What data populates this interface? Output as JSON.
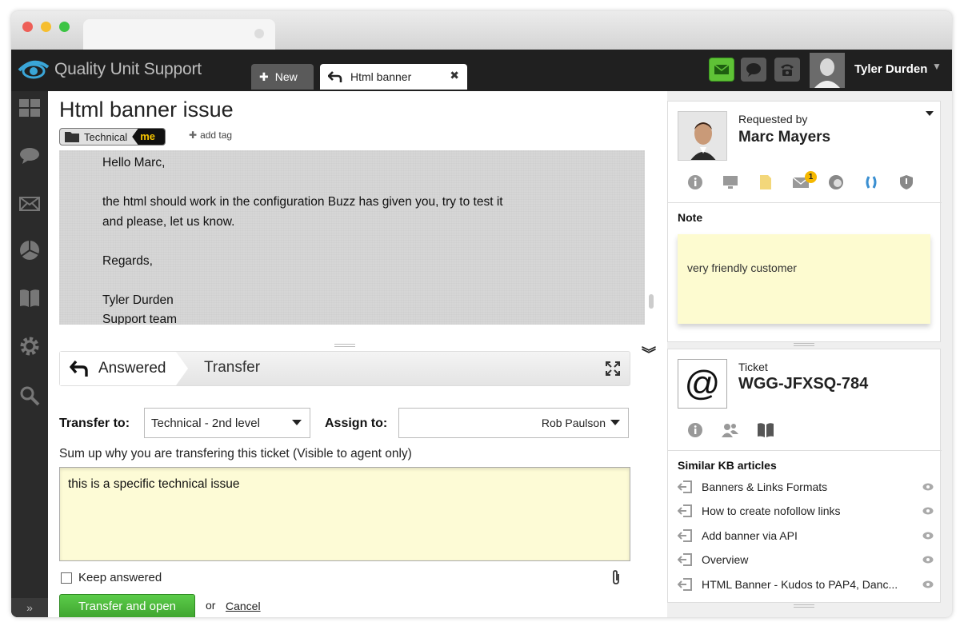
{
  "app": {
    "logo_text": "Quality Unit Support"
  },
  "tabs": {
    "new_label": "New",
    "active_label": "Html banner",
    "close_glyph": "✖"
  },
  "user": {
    "name": "Tyler Durden"
  },
  "ticket": {
    "title": "Html banner issue",
    "tag_label": "Technical",
    "tag_owner": "me",
    "add_tag_label": "add tag",
    "message_lines": [
      "Hello Marc,",
      "the html should work in the configuration Buzz has given you, try to test it",
      "and please, let us know.",
      "Regards,",
      "Tyler Durden",
      "Support team"
    ]
  },
  "actions": {
    "answered_label": "Answered",
    "transfer_label": "Transfer"
  },
  "transfer": {
    "transfer_to_label": "Transfer to:",
    "transfer_to_value": "Technical - 2nd level",
    "assign_to_label": "Assign to:",
    "assign_to_value": "Rob Paulson",
    "sum_up_label": "Sum up why you are transfering this ticket (Visible to agent only)",
    "note_value": "this is a specific technical issue",
    "keep_answered_label": "Keep answered",
    "submit_label": "Transfer and open",
    "or_label": "or",
    "cancel_label": "Cancel"
  },
  "requester": {
    "label": "Requested by",
    "name": "Marc Mayers",
    "mail_badge": "1",
    "note_title": "Note",
    "note_text": "very friendly customer"
  },
  "ticket_panel": {
    "label": "Ticket",
    "code": "WGG-JFXSQ-784",
    "kb_title": "Similar KB articles",
    "kb_articles": [
      "Banners & Links Formats",
      "How to create nofollow links",
      "Add banner via API",
      "Overview",
      "HTML Banner - Kudos to PAP4, Danc..."
    ]
  },
  "colors": {
    "accent_green": "#3ea32e",
    "note_yellow": "#fdfbd0",
    "appbar": "#202020",
    "tag_me": "#f5c400"
  }
}
